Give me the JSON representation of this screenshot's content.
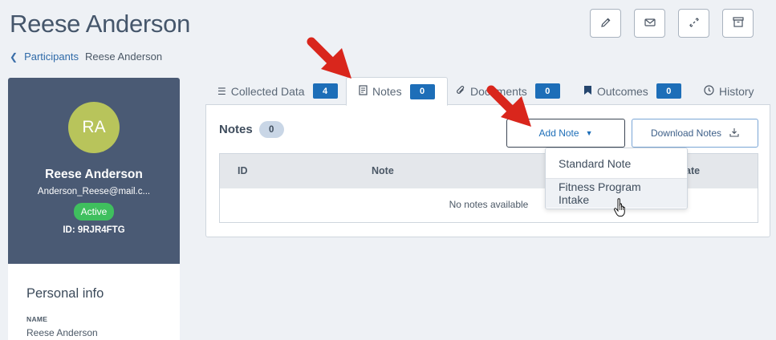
{
  "header": {
    "title": "Reese Anderson",
    "breadcrumb": {
      "back_icon": "chevron-left-icon",
      "parent": "Participants",
      "current": "Reese Anderson"
    },
    "actions": [
      {
        "name": "edit-icon",
        "glyph": "✎"
      },
      {
        "name": "mail-icon",
        "glyph": "✉"
      },
      {
        "name": "link-icon",
        "glyph": "🔗"
      },
      {
        "name": "archive-icon",
        "glyph": "▭"
      }
    ]
  },
  "profile": {
    "initials": "RA",
    "name": "Reese Anderson",
    "email": "Anderson_Reese@mail.c...",
    "status": "Active",
    "id": "ID: 9RJR4FTG"
  },
  "personal_info": {
    "heading": "Personal info",
    "name_label": "NAME",
    "name_value": "Reese Anderson"
  },
  "tabs": [
    {
      "label": "Collected Data",
      "count": "4",
      "icon": "list-icon"
    },
    {
      "label": "Notes",
      "count": "0",
      "icon": "notebook-icon",
      "active": true
    },
    {
      "label": "Documents",
      "count": "0",
      "icon": "paperclip-icon"
    },
    {
      "label": "Outcomes",
      "count": "0",
      "icon": "bookmark-icon"
    },
    {
      "label": "History",
      "icon": "clock-icon"
    }
  ],
  "notes": {
    "heading": "Notes",
    "count": "0",
    "add_button": "Add Note",
    "download_button": "Download Notes",
    "columns": [
      "ID",
      "Note",
      "Date"
    ],
    "empty_message": "No notes available",
    "dropdown_items": [
      "Standard Note",
      "Fitness Program Intake"
    ]
  },
  "colors": {
    "accent": "#1d6eb8",
    "profile_bg": "#4a5a74",
    "avatar_bg": "#b8c45b",
    "status_active": "#3fbf5e",
    "annotation_arrow": "#d9261c"
  }
}
